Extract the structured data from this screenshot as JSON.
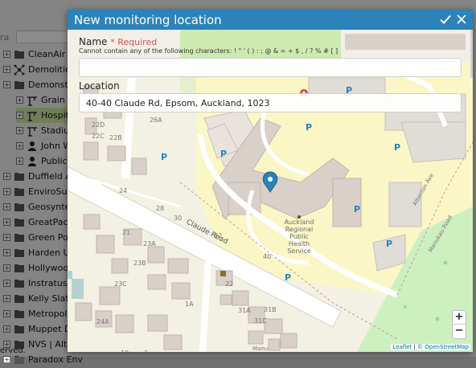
{
  "background": {
    "tree_items": [
      {
        "label": "CleanAir",
        "indent": 0,
        "icon": "folder-icon"
      },
      {
        "label": "Demolitions",
        "indent": 0,
        "icon": "network-icon"
      },
      {
        "label": "Demonstrat",
        "indent": 0,
        "icon": "folder-icon"
      },
      {
        "label": "Grain sil",
        "indent": 1,
        "icon": "crane-icon"
      },
      {
        "label": "Hospital",
        "indent": 1,
        "icon": "crane-icon",
        "selected": true
      },
      {
        "label": "Stadium",
        "indent": 1,
        "icon": "crane-icon"
      },
      {
        "label": "John W",
        "indent": 1,
        "icon": "person-icon"
      },
      {
        "label": "Public D",
        "indent": 1,
        "icon": "person-icon"
      },
      {
        "label": "Duffield Ass",
        "indent": 0,
        "icon": "folder-icon"
      },
      {
        "label": "EnviroSumn",
        "indent": 0,
        "icon": "folder-icon"
      },
      {
        "label": "Geosyntec",
        "indent": 0,
        "icon": "folder-icon"
      },
      {
        "label": "GreatPacific",
        "indent": 0,
        "icon": "folder-icon"
      },
      {
        "label": "Green Powe",
        "indent": 0,
        "icon": "folder-icon"
      },
      {
        "label": "Harden Up",
        "indent": 0,
        "icon": "folder-icon"
      },
      {
        "label": "Hollywood",
        "indent": 0,
        "icon": "folder-icon"
      },
      {
        "label": "Instratus Ma",
        "indent": 0,
        "icon": "folder-icon"
      },
      {
        "label": "Kelly Slater",
        "indent": 0,
        "icon": "folder-icon"
      },
      {
        "label": "Metropolis",
        "indent": 0,
        "icon": "folder-icon"
      },
      {
        "label": "Muppet De",
        "indent": 0,
        "icon": "folder-icon"
      },
      {
        "label": "NVS | Alta E",
        "indent": 0,
        "icon": "folder-icon"
      },
      {
        "label": "Paradox Env",
        "indent": 0,
        "icon": "folder-icon"
      }
    ],
    "status_text": "erved.",
    "left_label": "ra"
  },
  "modal": {
    "title": "New monitoring location",
    "name_field": {
      "label": "Name",
      "required_text": "* Required",
      "hint": "Cannot contain any of the following characters: ! \" ' ( ) : ; @ & = + $ , / ? % # [ ]",
      "value": "",
      "placeholder": ""
    },
    "location_field": {
      "label": "Location",
      "value": "40-40 Claude Rd, Epsom, Auckland, 1023"
    },
    "map": {
      "road_label": "Claude Road",
      "place_label_lines": [
        "Auckland",
        "Regional",
        "Public",
        "Health",
        "Service"
      ],
      "street_labels": [
        "Alberton Ave",
        "Manukau Road",
        "Manu"
      ],
      "house_numbers": [
        "26A",
        "22D",
        "22C",
        "22B",
        "24",
        "28",
        "30",
        "32",
        "40",
        "21",
        "23A",
        "23B",
        "23C",
        "1A",
        "24A",
        "31A",
        "31B",
        "31C",
        "22",
        "19",
        "2"
      ],
      "zoom_in": "+",
      "zoom_out": "−",
      "attribution_leaflet": "Leaflet",
      "attribution_sep": "|",
      "attribution_osm": "© OpenStreetMap",
      "parking_symbol": "P"
    },
    "colors": {
      "header": "#2b83ba",
      "required": "#d9534f",
      "marker": "#2b83ba",
      "park": "#d9f0c8",
      "building": "#d9d0c9"
    }
  }
}
